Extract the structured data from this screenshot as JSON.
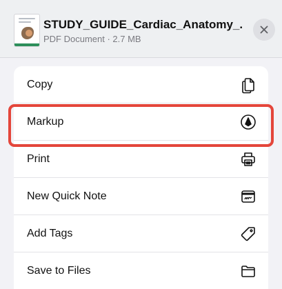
{
  "file": {
    "title": "STUDY_GUIDE_Cardiac_Anatomy_...",
    "meta": "PDF Document · 2.7 MB"
  },
  "close_icon": "close-icon",
  "actions": [
    {
      "label": "Copy",
      "icon": "copy-icon"
    },
    {
      "label": "Markup",
      "icon": "markup-icon"
    },
    {
      "label": "Print",
      "icon": "print-icon"
    },
    {
      "label": "New Quick Note",
      "icon": "quick-note-icon"
    },
    {
      "label": "Add Tags",
      "icon": "tag-icon"
    },
    {
      "label": "Save to Files",
      "icon": "folder-icon"
    }
  ],
  "highlight_color": "#e4463b"
}
